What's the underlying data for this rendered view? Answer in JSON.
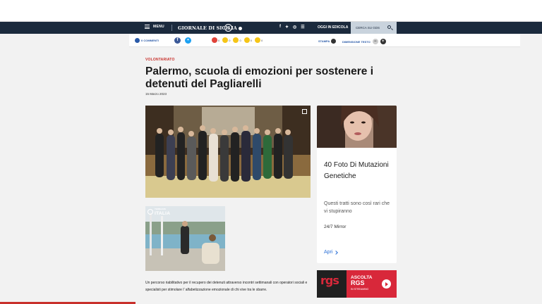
{
  "nav": {
    "menu_label": "MENU",
    "brand": "GIORNALE DI SICILIA",
    "brand_badge": "PA",
    "social_icons": [
      "facebook-icon",
      "twitter-icon",
      "instagram-icon",
      "rss-icon"
    ],
    "edicola_label": "OGGI IN EDICOLA",
    "search_label": "CERCA SU GDS",
    "colors": {
      "navbar": "#1b2a3d",
      "search_box": "#c9d3dd"
    }
  },
  "subbar": {
    "comments_label": "0 COMMENTI",
    "reactions": [
      "0",
      "0",
      "0",
      "0",
      "0"
    ],
    "print_label": "STAMPA",
    "text_size_label": "DIMENSIONE TESTO"
  },
  "article": {
    "category": "VOLONTARIATO",
    "title": "Palermo, scuola di emozioni per sostenere i detenuti del Pagliarelli",
    "date": "15 Marzo 2023",
    "body": "Un percorso riabilitativo per il recupero dei detenuti attraverso incontri settimanali con operatori sociali e specialisti per stimolare l’ alfabetizzazione emozionale di chi vive tra le sbarre.",
    "secondary_photo_logo_top": "TERRAZZE",
    "secondary_photo_logo_main": "ITALIA",
    "accent_color": "#c8302b"
  },
  "ad_card": {
    "title": "40 Foto Di Mutazioni Genetiche",
    "description": "Questi tratti sono così rari che vi stupiranno",
    "source": "24/7 Mirror",
    "cta": "Apri"
  },
  "radio_ad": {
    "logo": "rgs",
    "line1": "ASCOLTA",
    "line2": "RGS",
    "line3": "IN STREAMING",
    "color": "#d8283a"
  },
  "reading_progress": 0.25
}
